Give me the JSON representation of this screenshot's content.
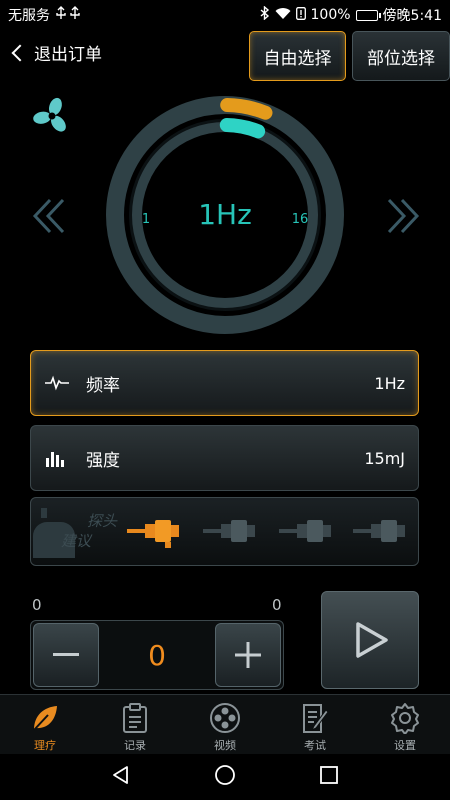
{
  "status_bar": {
    "carrier": "无服务",
    "battery": "100%",
    "time": "傍晚5:41"
  },
  "header": {
    "back_label": "退出订单",
    "mode_free": "自由选择",
    "mode_part": "部位选择"
  },
  "dial": {
    "value": "1Hz",
    "min": "1",
    "max": "16",
    "level_fraction": 0.06,
    "colors": {
      "track": "#2f4146",
      "level": "#2ed3c5",
      "highlight": "#e49b1c",
      "text": "#27c4b8"
    }
  },
  "params": [
    {
      "label": "频率",
      "value": "1Hz",
      "icon": "waveform-icon"
    },
    {
      "label": "强度",
      "value": "15mJ",
      "icon": "bars-icon"
    }
  ],
  "probe": {
    "suggest_label": "探头建议",
    "selected_index": 0
  },
  "counter": {
    "left_small": "0",
    "right_small": "0",
    "value": "0"
  },
  "tabs": [
    {
      "label": "理疗",
      "icon": "leaf-icon",
      "active": true
    },
    {
      "label": "记录",
      "icon": "clipboard-icon",
      "active": false
    },
    {
      "label": "视频",
      "icon": "film-reel-icon",
      "active": false
    },
    {
      "label": "考试",
      "icon": "pen-paper-icon",
      "active": false
    },
    {
      "label": "设置",
      "icon": "gear-icon",
      "active": false
    }
  ],
  "accent": "#e49b1c"
}
